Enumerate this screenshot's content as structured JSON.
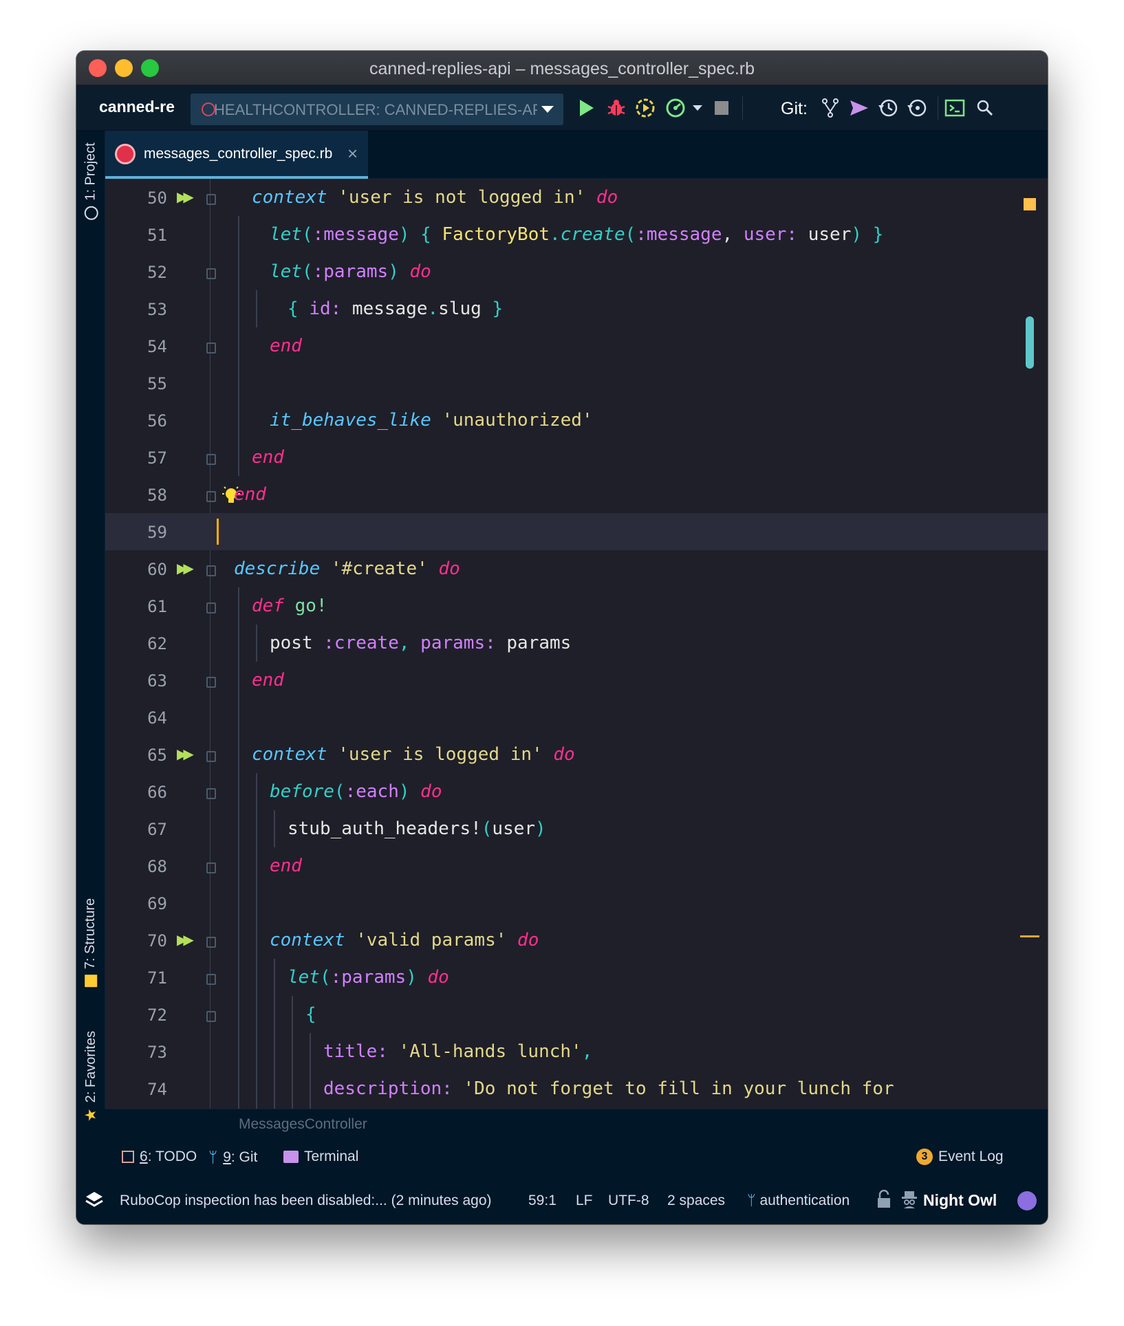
{
  "window": {
    "title": "canned-replies-api – messages_controller_spec.rb"
  },
  "toolbar": {
    "project_name": "canned-replies-api",
    "run_config": "HEALTHCONTROLLER: CANNED-REPLIES-API",
    "git_label": "Git:",
    "icons": [
      "run-icon",
      "debug-icon",
      "run-with-coverage-icon",
      "profiler-icon",
      "stop-icon",
      "git-branches-icon",
      "git-push-icon",
      "git-history-icon",
      "git-revert-icon",
      "terminal-icon",
      "search-icon"
    ]
  },
  "left_stripe": {
    "project": "1: Project",
    "structure": "7: Structure",
    "favorites": "2: Favorites"
  },
  "tab": {
    "label": "messages_controller_spec.rb",
    "close": "×"
  },
  "colors": {
    "background": "#1f1f29",
    "keyword": "#ff2f8e",
    "context": "#57c7ff",
    "string": "#e3d889",
    "symbol": "#d080ff",
    "bracket": "#31d0c9"
  },
  "lines": [
    {
      "n": "50",
      "run": true
    },
    {
      "n": "51"
    },
    {
      "n": "52"
    },
    {
      "n": "53"
    },
    {
      "n": "54"
    },
    {
      "n": "55"
    },
    {
      "n": "56"
    },
    {
      "n": "57"
    },
    {
      "n": "58"
    },
    {
      "n": "59"
    },
    {
      "n": "60",
      "run": true
    },
    {
      "n": "61"
    },
    {
      "n": "62"
    },
    {
      "n": "63"
    },
    {
      "n": "64"
    },
    {
      "n": "65",
      "run": true
    },
    {
      "n": "66"
    },
    {
      "n": "67"
    },
    {
      "n": "68"
    },
    {
      "n": "69"
    },
    {
      "n": "70",
      "run": true
    },
    {
      "n": "71"
    },
    {
      "n": "72"
    },
    {
      "n": "73"
    },
    {
      "n": "74"
    }
  ],
  "code": {
    "l50": {
      "a": "context",
      "b": " ",
      "c": "'user is not logged in'",
      "d": " ",
      "e": "do"
    },
    "l51": {
      "a": "let",
      "b": "(",
      "c": ":message",
      "d": ")",
      "e": " { ",
      "f": "FactoryBot",
      "g": ".",
      "h": "create",
      "i": "(",
      "j": ":message",
      "k": ", ",
      "l": "user:",
      "m": " user",
      "n": ") }"
    },
    "l52": {
      "a": "let",
      "b": "(",
      "c": ":params",
      "d": ")",
      "e": " ",
      "f": "do"
    },
    "l53": {
      "a": "{ ",
      "b": "id:",
      "c": " message",
      "d": ".",
      "e": "slug",
      "f": " }"
    },
    "l54": {
      "a": "end"
    },
    "l56": {
      "a": "it_behaves_like",
      "b": " ",
      "c": "'unauthorized'"
    },
    "l57": {
      "a": "end"
    },
    "l58": {
      "a": "end"
    },
    "l60": {
      "a": "describe",
      "b": " ",
      "c": "'#create'",
      "d": " ",
      "e": "do"
    },
    "l61": {
      "a": "def",
      "b": " ",
      "c": "go!"
    },
    "l62": {
      "a": "post ",
      "b": ":create",
      "c": ", ",
      "d": "params:",
      "e": " params"
    },
    "l63": {
      "a": "end"
    },
    "l65": {
      "a": "context",
      "b": " ",
      "c": "'user is logged in'",
      "d": " ",
      "e": "do"
    },
    "l66": {
      "a": "before",
      "b": "(",
      "c": ":each",
      "d": ")",
      "e": " ",
      "f": "do"
    },
    "l67": {
      "a": "stub_auth_headers!",
      "b": "(",
      "c": "user",
      "d": ")"
    },
    "l68": {
      "a": "end"
    },
    "l70": {
      "a": "context",
      "b": " ",
      "c": "'valid params'",
      "d": " ",
      "e": "do"
    },
    "l71": {
      "a": "let",
      "b": "(",
      "c": ":params",
      "d": ")",
      "e": " ",
      "f": "do"
    },
    "l72": {
      "a": "{"
    },
    "l73": {
      "a": "title:",
      "b": " ",
      "c": "'All-hands lunch'",
      "d": ","
    },
    "l74": {
      "a": "description:",
      "b": " ",
      "c": "'Do not forget to fill in your lunch for"
    }
  },
  "breadcrumb": "MessagesController",
  "tool_windows": {
    "todo_num": "6",
    "todo": ": TODO",
    "git_num": "9",
    "git": ": Git",
    "terminal": "Terminal",
    "event_count": "3",
    "event_log": "Event Log"
  },
  "status": {
    "message": "RuboCop inspection has been disabled:... (2 minutes ago)",
    "position": "59:1",
    "line_sep": "LF",
    "encoding": "UTF-8",
    "indent": "2 spaces",
    "branch": "authentication",
    "theme": "Night Owl"
  }
}
